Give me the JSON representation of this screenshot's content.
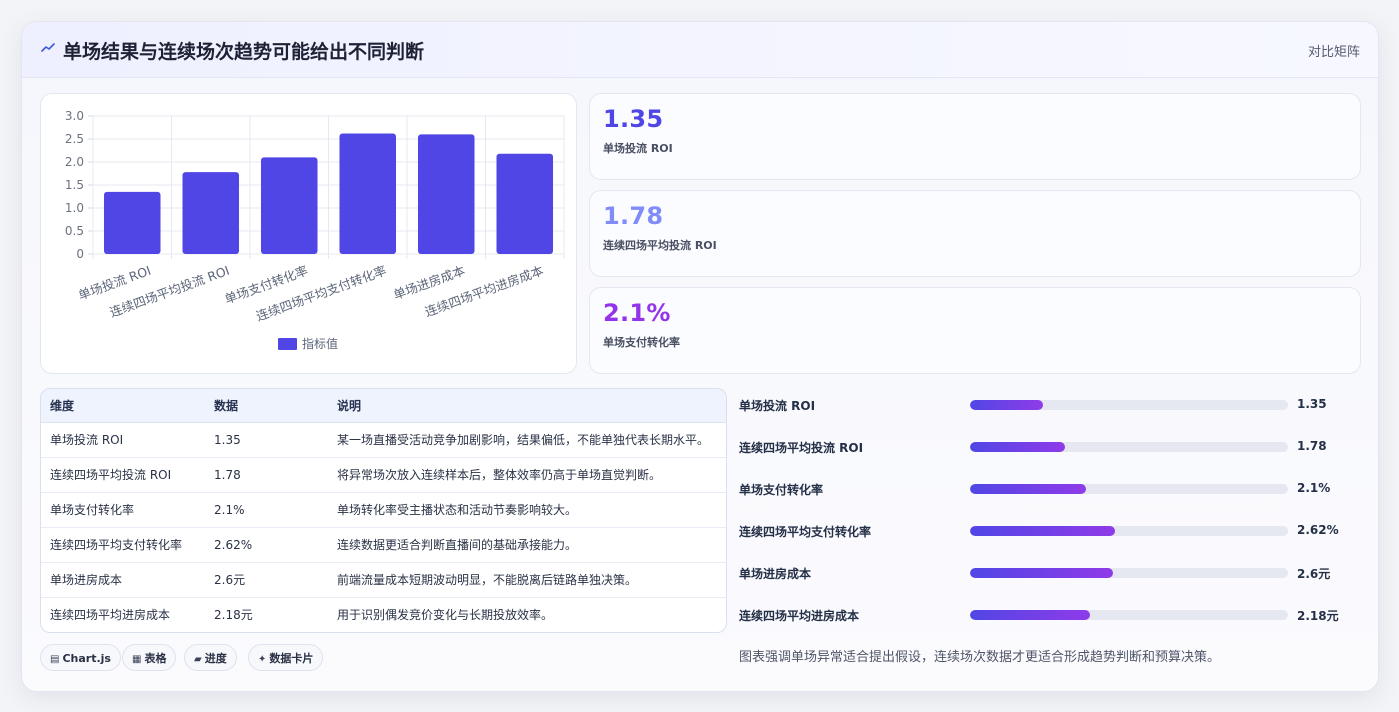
{
  "header": {
    "icon": "trend-line-icon",
    "title": "单场结果与连续场次趋势可能给出不同判断",
    "link_label": "对比矩阵"
  },
  "chart_data": {
    "type": "bar",
    "categories": [
      "单场投流 ROI",
      "连续四场平均投流 ROI",
      "单场支付转化率",
      "连续四场平均支付转化率",
      "单场进房成本",
      "连续四场平均进房成本"
    ],
    "series": [
      {
        "name": "指标值",
        "values": [
          1.35,
          1.78,
          2.1,
          2.62,
          2.6,
          2.18
        ]
      }
    ],
    "ylim": [
      0,
      3.0
    ],
    "yticks": [
      "3.0",
      "2.5",
      "2.0",
      "1.5",
      "1.0",
      "0.5",
      "0"
    ],
    "grid": true,
    "legend": "bottom",
    "bar_color": "#5046e5"
  },
  "stats": [
    {
      "value": "1.35",
      "label": "单场投流 ROI",
      "color": "#4f46e5"
    },
    {
      "value": "1.78",
      "label": "连续四场平均投流 ROI",
      "color": "#818cf8"
    },
    {
      "value": "2.1%",
      "label": "单场支付转化率",
      "color": "#9333ea"
    }
  ],
  "table": {
    "headers": [
      "维度",
      "数据",
      "说明"
    ],
    "rows": [
      [
        "单场投流 ROI",
        "1.35",
        "某一场直播受活动竞争加剧影响，结果偏低，不能单独代表长期水平。"
      ],
      [
        "连续四场平均投流 ROI",
        "1.78",
        "将异常场次放入连续样本后，整体效率仍高于单场直觉判断。"
      ],
      [
        "单场支付转化率",
        "2.1%",
        "单场转化率受主播状态和活动节奏影响较大。"
      ],
      [
        "连续四场平均支付转化率",
        "2.62%",
        "连续数据更适合判断直播间的基础承接能力。"
      ],
      [
        "单场进房成本",
        "2.6元",
        "前端流量成本短期波动明显，不能脱离后链路单独决策。"
      ],
      [
        "连续四场平均进房成本",
        "2.18元",
        "用于识别偶发竞价变化与长期投放效率。"
      ]
    ]
  },
  "chips": [
    {
      "icon": "chart-icon",
      "glyph": "▤",
      "label": "Chart.js"
    },
    {
      "icon": "table-icon",
      "glyph": "▦",
      "label": "表格"
    },
    {
      "icon": "progress-icon",
      "glyph": "▰",
      "label": "进度"
    },
    {
      "icon": "sparkle-icon",
      "glyph": "✦",
      "label": "数据卡片"
    }
  ],
  "progress": [
    {
      "label": "单场投流 ROI",
      "value": "1.35",
      "fraction": 0.23
    },
    {
      "label": "连续四场平均投流 ROI",
      "value": "1.78",
      "fraction": 0.3
    },
    {
      "label": "单场支付转化率",
      "value": "2.1%",
      "fraction": 0.365
    },
    {
      "label": "连续四场平均支付转化率",
      "value": "2.62%",
      "fraction": 0.455
    },
    {
      "label": "单场进房成本",
      "value": "2.6元",
      "fraction": 0.451
    },
    {
      "label": "连续四场平均进房成本",
      "value": "2.18元",
      "fraction": 0.378
    }
  ],
  "footnote": "图表强调单场异常适合提出假设，连续场次数据才更适合形成趋势判断和预算决策。"
}
